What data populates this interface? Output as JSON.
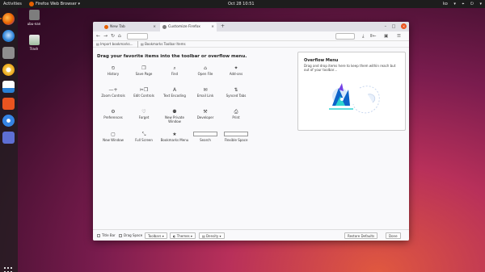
{
  "topbar": {
    "activities": "Activities",
    "app_name": "Firefox Web Browser",
    "clock": "Oct 28 10:51",
    "tray": [
      "ko",
      "▾",
      "⌖",
      "⏻",
      "▾"
    ]
  },
  "desktop": {
    "home_label": "ubu-nan",
    "trash_label": "Trash"
  },
  "browser": {
    "tabs": [
      {
        "label": "New Tab",
        "close": "×"
      },
      {
        "label": "Customize Firefox",
        "close": "×"
      }
    ],
    "new_tab": "+",
    "window_controls": {
      "minimize": "–",
      "maximize": "□",
      "close": "×"
    },
    "nav": {
      "back": "←",
      "forward": "→",
      "reload": "↻",
      "home": "⌂"
    },
    "toolbar_right": [
      "⤓",
      "Ⅱ←",
      "▣",
      "☰"
    ],
    "bookmarks": [
      {
        "label": "Import bookmarks..."
      },
      {
        "label": "Bookmarks Toolbar Items"
      }
    ],
    "page_heading": "Drag your favorite items into the toolbar or overflow menu.",
    "palette": [
      {
        "icon": "⏲",
        "label": "History"
      },
      {
        "icon": "❐",
        "label": "Save Page"
      },
      {
        "icon": "⌕",
        "label": "Find"
      },
      {
        "icon": "⌂",
        "label": "Open File"
      },
      {
        "icon": "✦",
        "label": "Add-ons"
      },
      {
        "icon": "—+",
        "label": "Zoom Controls"
      },
      {
        "icon": "✂❐",
        "label": "Edit Controls"
      },
      {
        "icon": "A",
        "label": "Text Encoding"
      },
      {
        "icon": "✉",
        "label": "Email Link"
      },
      {
        "icon": "⇅",
        "label": "Synced Tabs"
      },
      {
        "icon": "⚙",
        "label": "Preferences"
      },
      {
        "icon": "♡",
        "label": "Forget"
      },
      {
        "icon": "⚉",
        "label": "New Private Window"
      },
      {
        "icon": "⚒",
        "label": "Developer"
      },
      {
        "icon": "⎙",
        "label": "Print"
      },
      {
        "icon": "▢",
        "label": "New Window"
      },
      {
        "icon": "⤡",
        "label": "Full Screen"
      },
      {
        "icon": "★",
        "label": "Bookmarks Menu"
      },
      {
        "icon": "",
        "label": "Search"
      },
      {
        "icon": "",
        "label": "Flexible Space"
      }
    ],
    "overflow": {
      "title": "Overflow Menu",
      "description": "Drag and drop items here to keep them within reach but out of your toolbar…"
    },
    "footer": {
      "title_bar": "Title Bar",
      "drag_space": "Drag Space",
      "toolbars": "Toolbars ▾",
      "themes": "◐ Themes ▾",
      "density": "▤ Density ▾",
      "restore": "Restore Defaults",
      "done": "Done"
    }
  }
}
